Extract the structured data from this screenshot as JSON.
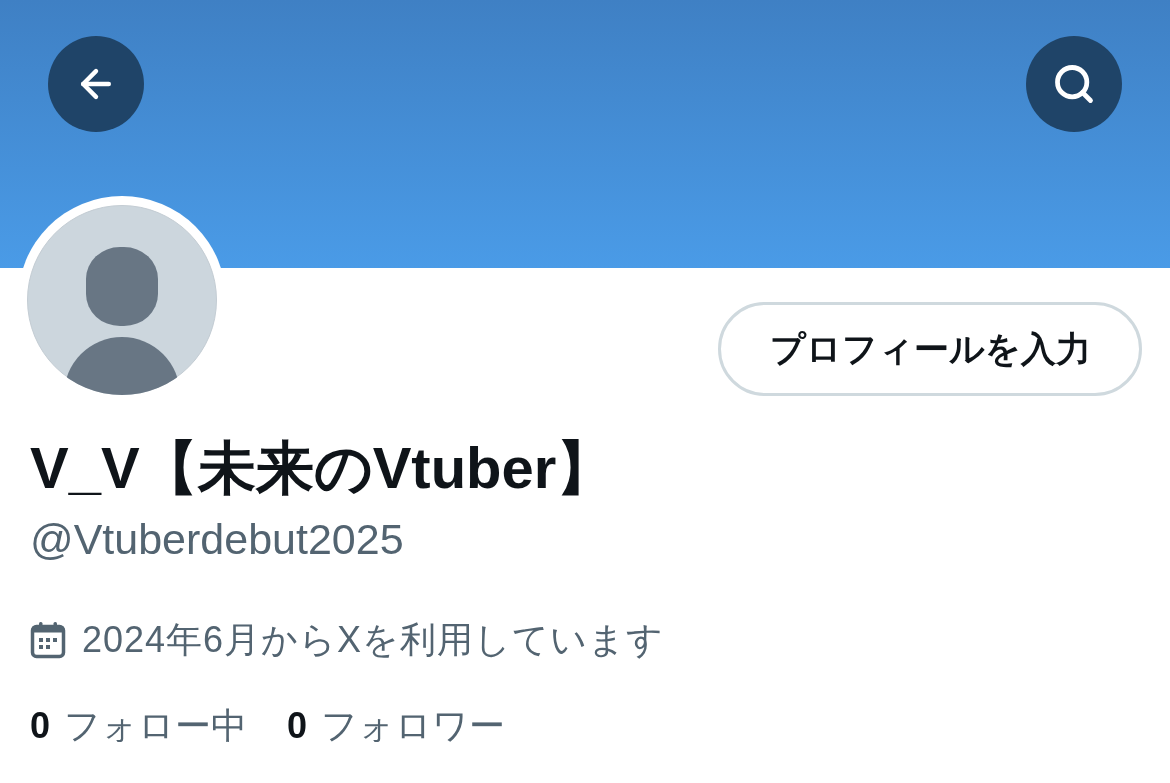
{
  "header": {
    "buttons": [
      {
        "kind": "back"
      },
      {
        "kind": "search"
      }
    ]
  },
  "profile": {
    "edit_button": "プロフィールを入力",
    "display_name": "V_V【未来のVtuber】",
    "handle": "@Vtuberdebut2025",
    "joined": "2024年6月からXを利用しています",
    "follow_stats": [
      {
        "count": "0",
        "label": "フォロー中"
      },
      {
        "count": "0",
        "label": "フォロワー"
      }
    ]
  }
}
